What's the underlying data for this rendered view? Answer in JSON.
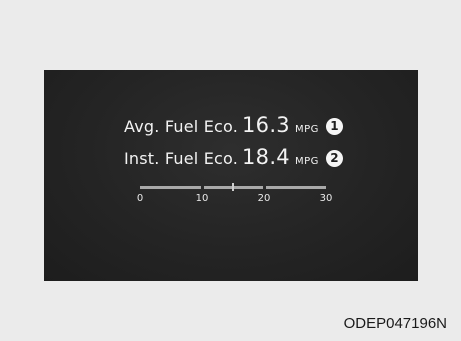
{
  "display": {
    "avg": {
      "label": "Avg. Fuel Eco.",
      "value": "16.3",
      "unit": "MPG",
      "marker": "1"
    },
    "inst": {
      "label": "Inst. Fuel Eco.",
      "value": "18.4",
      "unit": "MPG",
      "marker": "2"
    },
    "scale": {
      "ticks": [
        "0",
        "10",
        "20",
        "30"
      ],
      "min": 0,
      "max": 30,
      "indicator_value": 15
    }
  },
  "caption": "ODEP047196N",
  "colors": {
    "screen_background": "#242424",
    "text": "#f2f2f2",
    "scale_bar": "#a9a9a9",
    "page_background": "#ebebeb"
  }
}
